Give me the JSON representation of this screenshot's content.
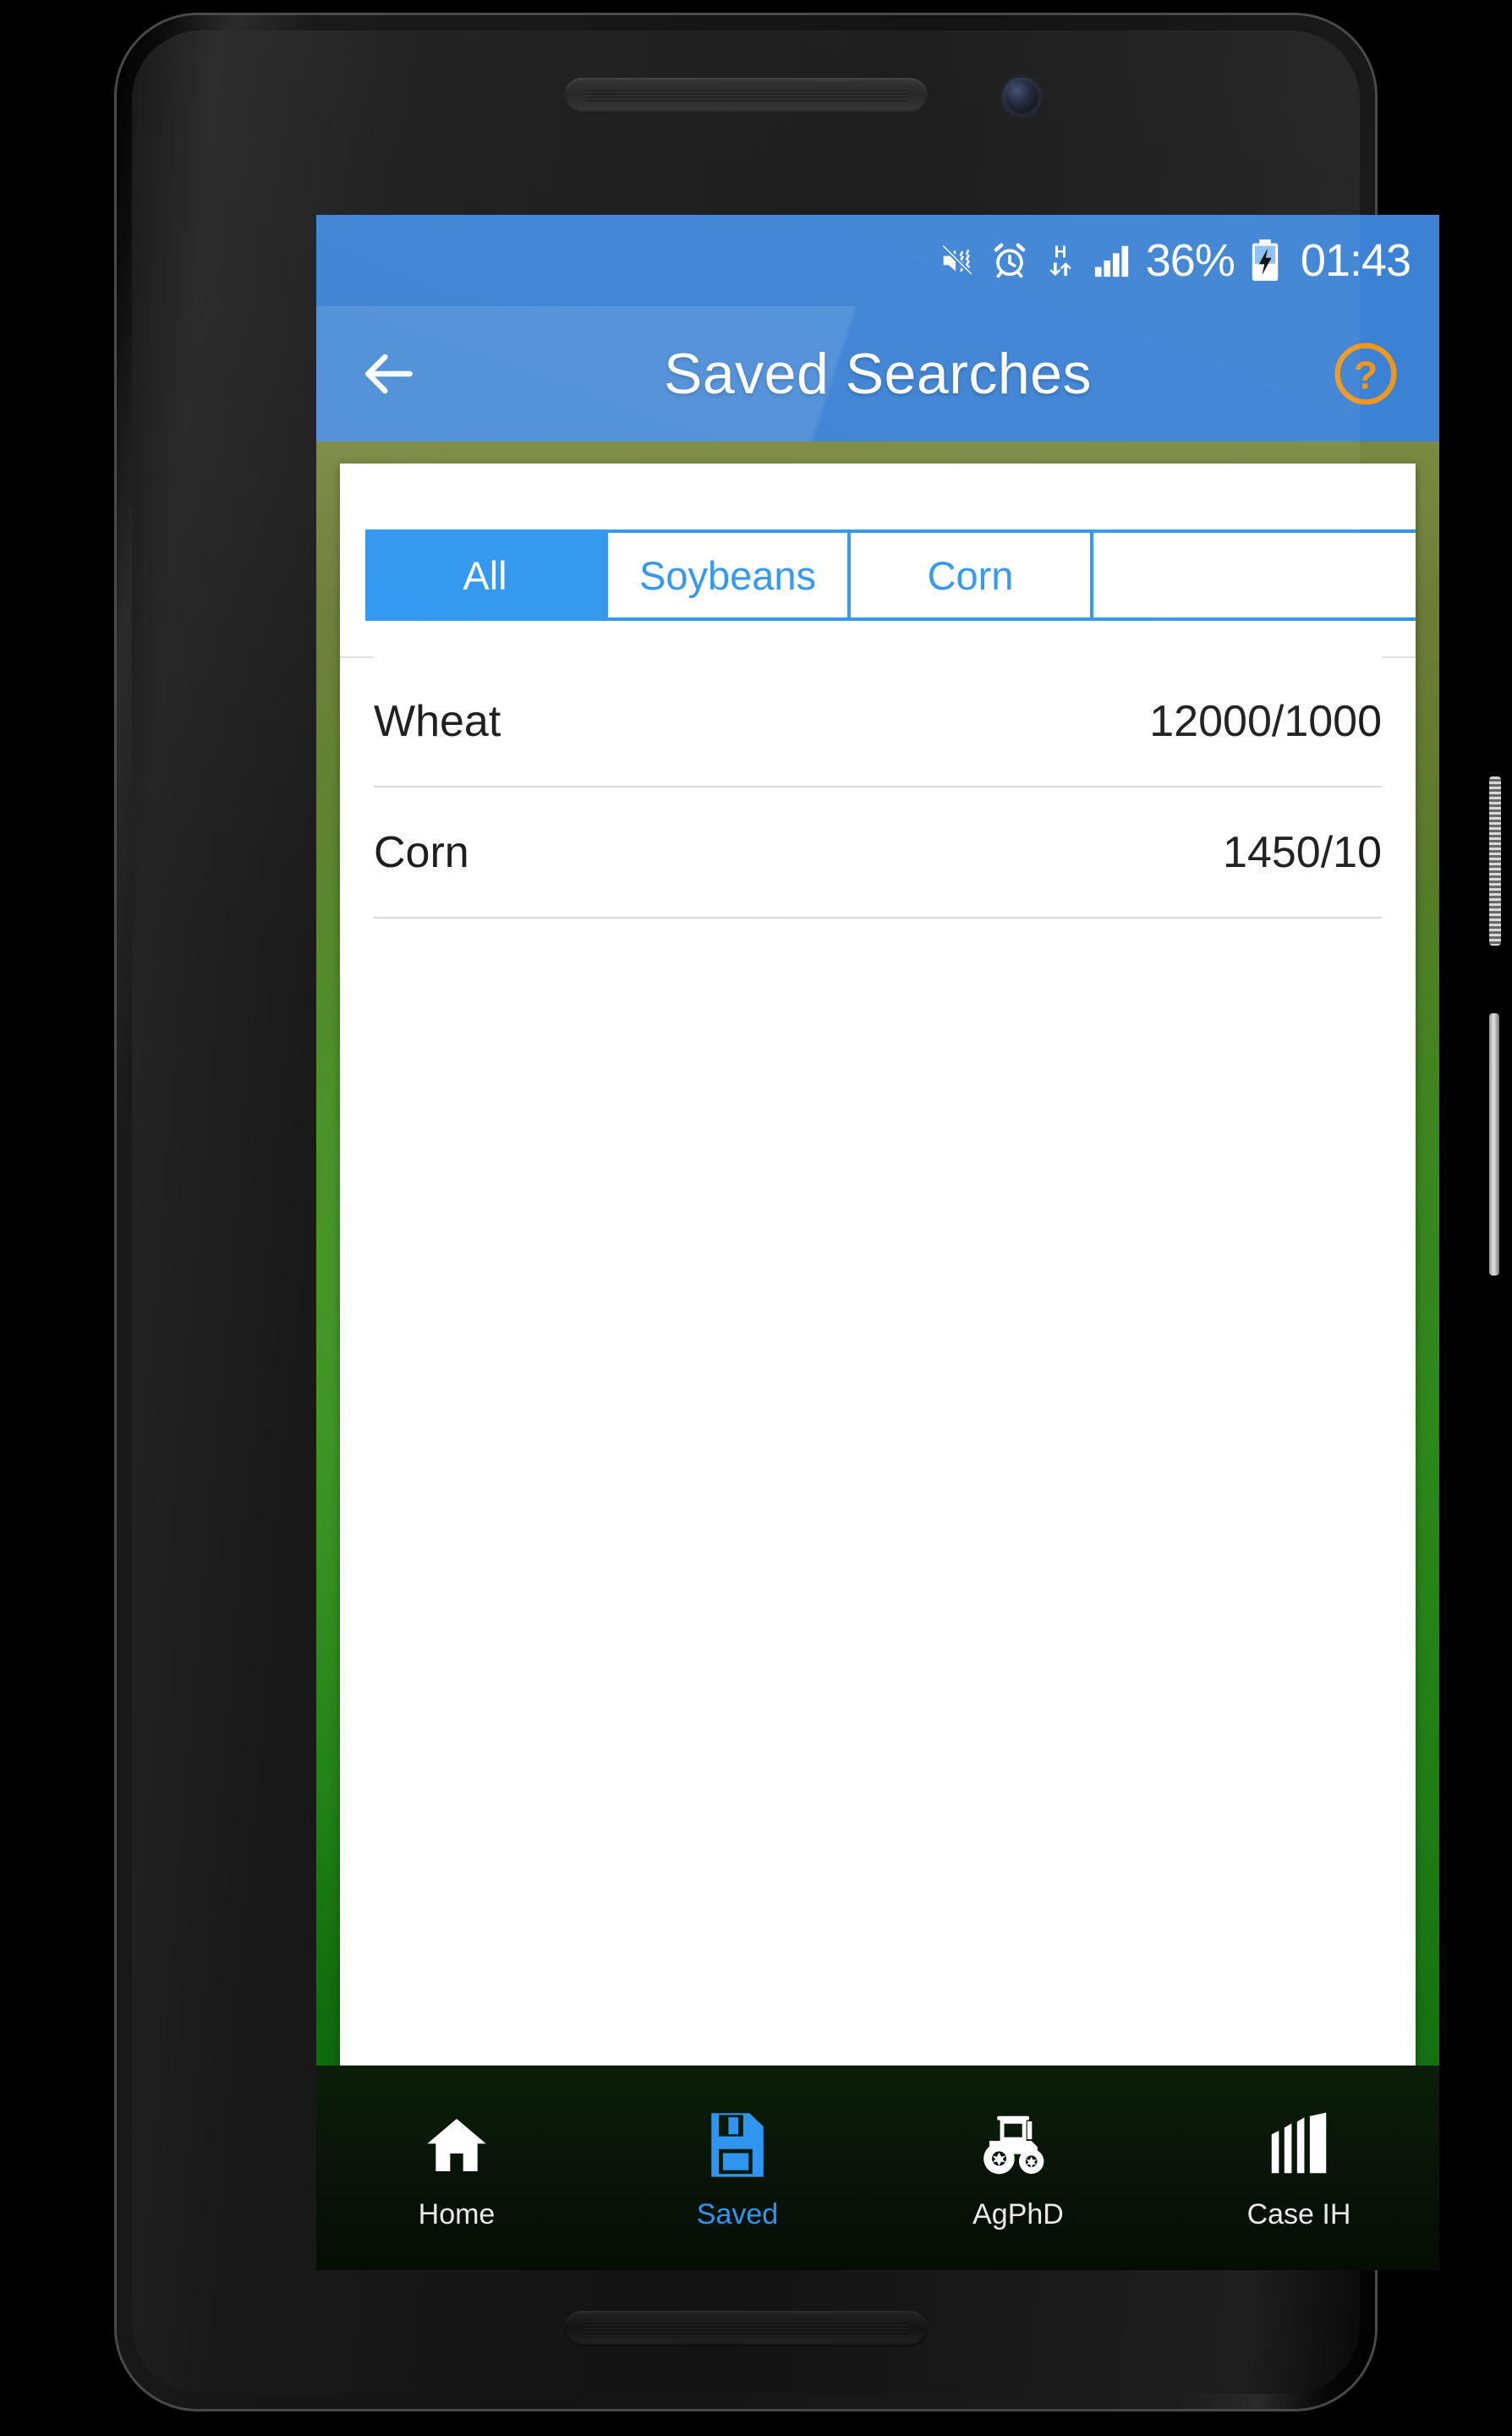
{
  "status_bar": {
    "icons": [
      "mute-vibrate-icon",
      "alarm-icon",
      "hspa-data-icon",
      "signal-bars-icon"
    ],
    "hspa_letter": "H",
    "battery_percent": "36%",
    "clock": "01:43",
    "background_color": "#3b82d4"
  },
  "app_bar": {
    "back_icon": "back-arrow-icon",
    "title": "Saved Searches",
    "help_icon": "help-question-icon",
    "background_color": "#3b82d4",
    "help_color": "#f0971a"
  },
  "tabs": {
    "active_color": "#2f96f0",
    "items": [
      {
        "label": "All",
        "active": true
      },
      {
        "label": "Soybeans",
        "active": false
      },
      {
        "label": "Corn",
        "active": false
      },
      {
        "label": "",
        "active": false,
        "partial": true
      }
    ]
  },
  "saved_list": {
    "rows": [
      {
        "name": "Wheat",
        "value": "12000/1000"
      },
      {
        "name": "Corn",
        "value": "1450/10"
      }
    ]
  },
  "bottom_nav": {
    "active_color": "#2f96f0",
    "items": [
      {
        "label": "Home",
        "icon": "home-icon",
        "active": false
      },
      {
        "label": "Saved",
        "icon": "floppy-disk-icon",
        "active": true
      },
      {
        "label": "AgPhD",
        "icon": "tractor-icon",
        "active": false
      },
      {
        "label": "Case IH",
        "icon": "case-ih-logo-icon",
        "active": false
      }
    ]
  },
  "device": {
    "earpiece": "earpiece-speaker",
    "front_camera": "front-camera",
    "bottom_speaker": "bottom-speaker",
    "power_button": "power-button",
    "volume_button": "volume-button"
  }
}
